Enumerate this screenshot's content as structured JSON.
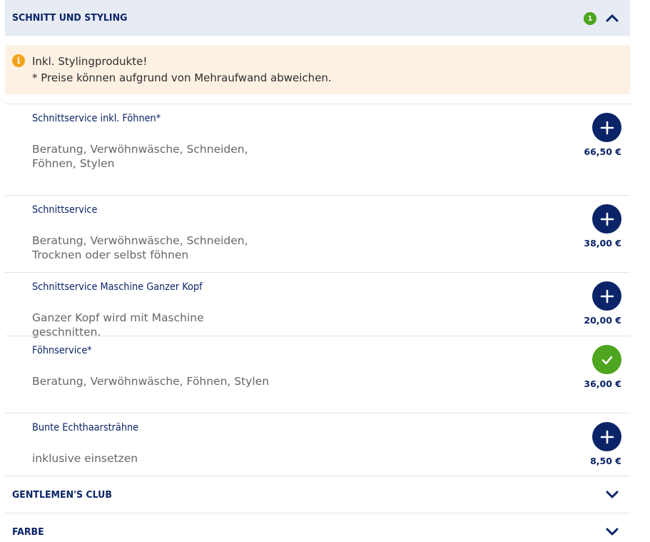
{
  "section_open": {
    "title": "SCHNITT UND STYLING",
    "badge_count": "1",
    "chevron_icon": "chevron-up-icon"
  },
  "notice": {
    "icon": "info-icon",
    "icon_glyph": "i",
    "line1": "Inkl. Stylingprodukte!",
    "line2": "* Preise können aufgrund von Mehraufwand abweichen."
  },
  "services": [
    {
      "title": "Schnittservice inkl. Föhnen*",
      "description": "Beratung, Verwöhnwäsche, Schneiden, Föhnen, Stylen",
      "price": "66,50 €",
      "selected": false
    },
    {
      "title": "Schnittservice",
      "description": "Beratung, Verwöhnwäsche, Schneiden, Trocknen oder selbst föhnen",
      "price": "38,00 €",
      "selected": false
    },
    {
      "title": "Schnittservice Maschine Ganzer Kopf",
      "description": "Ganzer Kopf wird mit Maschine geschnitten.",
      "price": "20,00 €",
      "selected": false
    },
    {
      "title": "Föhnservice*",
      "description": "Beratung, Verwöhnwäsche, Föhnen, Stylen",
      "price": "36,00 €",
      "selected": true
    },
    {
      "title": "Bunte Echthaarsträhne",
      "description": "inklusive einsetzen",
      "price": "8,50 €",
      "selected": false
    }
  ],
  "sections_closed": [
    {
      "title": "GENTLEMEN'S CLUB",
      "chevron_icon": "chevron-down-icon"
    },
    {
      "title": "FARBE",
      "chevron_icon": "chevron-down-icon"
    }
  ],
  "colors": {
    "navy": "#0b2468",
    "green": "#4ea51f",
    "orange": "#f2a31b",
    "header_bg": "#e6ebf4",
    "notice_bg": "#fdf1e4"
  }
}
